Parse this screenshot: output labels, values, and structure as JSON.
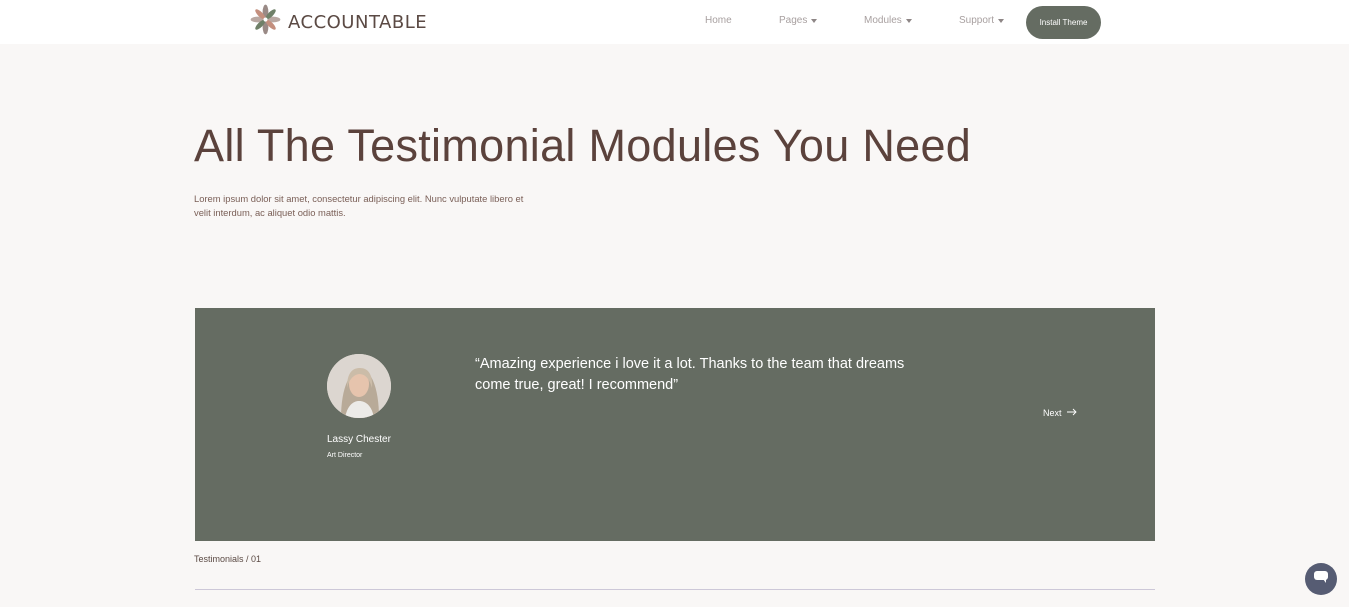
{
  "brand": {
    "name": "ACCOUNTABLE",
    "logo_icon": "flower-logo-icon"
  },
  "nav": {
    "items": [
      {
        "label": "Home",
        "has_dropdown": false
      },
      {
        "label": "Pages",
        "has_dropdown": true
      },
      {
        "label": "Modules",
        "has_dropdown": true
      },
      {
        "label": "Support",
        "has_dropdown": true
      }
    ],
    "cta_label": "Install Theme"
  },
  "hero": {
    "title": "All The Testimonial Modules You Need",
    "subtitle": "Lorem ipsum dolor sit amet, consectetur adipiscing elit. Nunc vulputate libero et velit interdum, ac aliquet odio mattis."
  },
  "testimonial": {
    "quote": "“Amazing experience i love it a lot. Thanks to the team that dreams come true, great! I recommend”",
    "name": "Lassy Chester",
    "role": "Art Director",
    "next_label": "Next",
    "next_icon": "arrow-right-icon"
  },
  "footer": {
    "breadcrumb": "Testimonials / 01"
  },
  "colors": {
    "background": "#f9f7f6",
    "card": "#656c62",
    "heading": "#5b423c",
    "chat_button": "#565c73"
  },
  "chat": {
    "icon": "chat-bubble-icon"
  }
}
